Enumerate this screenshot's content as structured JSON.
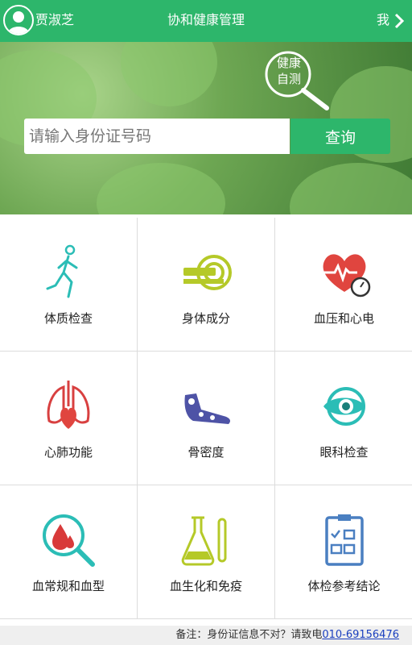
{
  "header": {
    "user_name": "贾淑芝",
    "title": "协和健康管理",
    "me_label": "我",
    "bg_color": "#2db66b"
  },
  "banner": {
    "badge_text": "健康\n自测",
    "search_placeholder": "请输入身份证号码",
    "search_button": "查询"
  },
  "tiles": [
    {
      "label": "体质检查",
      "icon": "running-person-icon"
    },
    {
      "label": "身体成分",
      "icon": "body-scanner-icon"
    },
    {
      "label": "血压和心电",
      "icon": "heart-pressure-gauge-icon"
    },
    {
      "label": "心肺功能",
      "icon": "heart-lungs-icon"
    },
    {
      "label": "骨密度",
      "icon": "foot-bones-icon"
    },
    {
      "label": "眼科检查",
      "icon": "eye-icon"
    },
    {
      "label": "血常规和血型",
      "icon": "blood-drop-magnifier-icon"
    },
    {
      "label": "血生化和免疫",
      "icon": "lab-flask-icon"
    },
    {
      "label": "体检参考结论",
      "icon": "clipboard-checklist-icon"
    }
  ],
  "footer": {
    "note": "备注：身份证信息不对？请致电",
    "phone": "010-69156476"
  }
}
